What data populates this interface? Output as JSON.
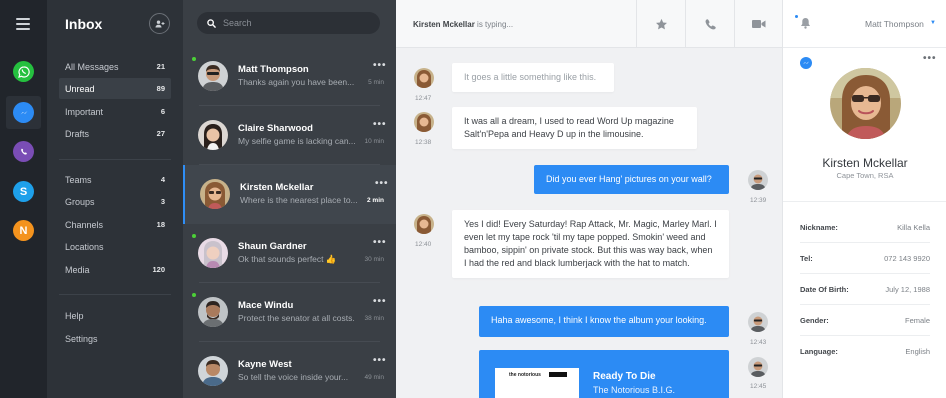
{
  "apps": [
    {
      "name": "WhatsApp",
      "icon": "whatsapp-icon",
      "color": "#25c03f"
    },
    {
      "name": "Messenger",
      "icon": "messenger-icon",
      "color": "#2c8bf4"
    },
    {
      "name": "Viber",
      "icon": "viber-icon",
      "color": "#7a4db5"
    },
    {
      "name": "Skype",
      "icon": "skype-icon",
      "color": "#1ea0ea"
    },
    {
      "name": "N",
      "icon": "n-app-icon",
      "color": "#f4931e"
    }
  ],
  "nav": {
    "title": "Inbox",
    "items": [
      {
        "label": "All Messages",
        "count": "21"
      },
      {
        "label": "Unread",
        "count": "89"
      },
      {
        "label": "Important",
        "count": "6"
      },
      {
        "label": "Drafts",
        "count": "27"
      }
    ],
    "groups": [
      {
        "label": "Teams",
        "count": "4"
      },
      {
        "label": "Groups",
        "count": "3"
      },
      {
        "label": "Channels",
        "count": "18"
      },
      {
        "label": "Locations",
        "count": ""
      },
      {
        "label": "Media",
        "count": "120"
      }
    ],
    "bottom": [
      {
        "label": "Help"
      },
      {
        "label": "Settings"
      }
    ]
  },
  "search": {
    "placeholder": "Search"
  },
  "conversations": [
    {
      "name": "Matt Thompson",
      "preview": "Thanks again you have been...",
      "time": "5 min"
    },
    {
      "name": "Claire Sharwood",
      "preview": "My selfie game is lacking can...",
      "time": "10 min"
    },
    {
      "name": "Kirsten Mckellar",
      "preview": "Where is the nearest place to...",
      "time": "2 min"
    },
    {
      "name": "Shaun Gardner",
      "preview": "Ok that sounds perfect 👍",
      "time": "30 min"
    },
    {
      "name": "Mace Windu",
      "preview": "Protect the senator at all costs.",
      "time": "38 min"
    },
    {
      "name": "Kayne West",
      "preview": "So tell the voice inside your...",
      "time": "49 min"
    }
  ],
  "chat": {
    "typing_name": "Kirsten Mckellar",
    "typing_suffix": "is typing...",
    "messages": [
      {
        "text": "It goes a little something like this.",
        "time": "12:47"
      },
      {
        "text": "It was all a dream, I used to read Word Up magazine Salt'n'Pepa and Heavy D up in the limousine.",
        "time": "12:38"
      },
      {
        "text": "Did you ever Hang' pictures on your wall?",
        "time": "12:39"
      },
      {
        "text": "Yes I did! Every Saturday! Rap Attack, Mr. Magic, Marley Marl. I even let my tape rock 'til my tape popped. Smokin' weed and bamboo, sippin' on private stock.  But this was way back, when I had the red and black lumberjack with the hat to match.",
        "time": "12:40"
      },
      {
        "text": "Haha awesome,  I think I know the album your looking.",
        "time": "12:43"
      },
      {
        "song": "Ready To Die",
        "artist": "The Notorious B.I.G.",
        "cover_label": "the notorious",
        "time": "12:45"
      }
    ]
  },
  "profile": {
    "user": "Matt Thompson",
    "name": "Kirsten Mckellar",
    "location": "Cape Town, RSA",
    "details": [
      {
        "key": "Nickname:",
        "value": "Killa Kella"
      },
      {
        "key": "Tel:",
        "value": "072 143 9920"
      },
      {
        "key": "Date Of Birth:",
        "value": "July 12, 1988"
      },
      {
        "key": "Gender:",
        "value": "Female"
      },
      {
        "key": "Language:",
        "value": "English"
      }
    ]
  }
}
